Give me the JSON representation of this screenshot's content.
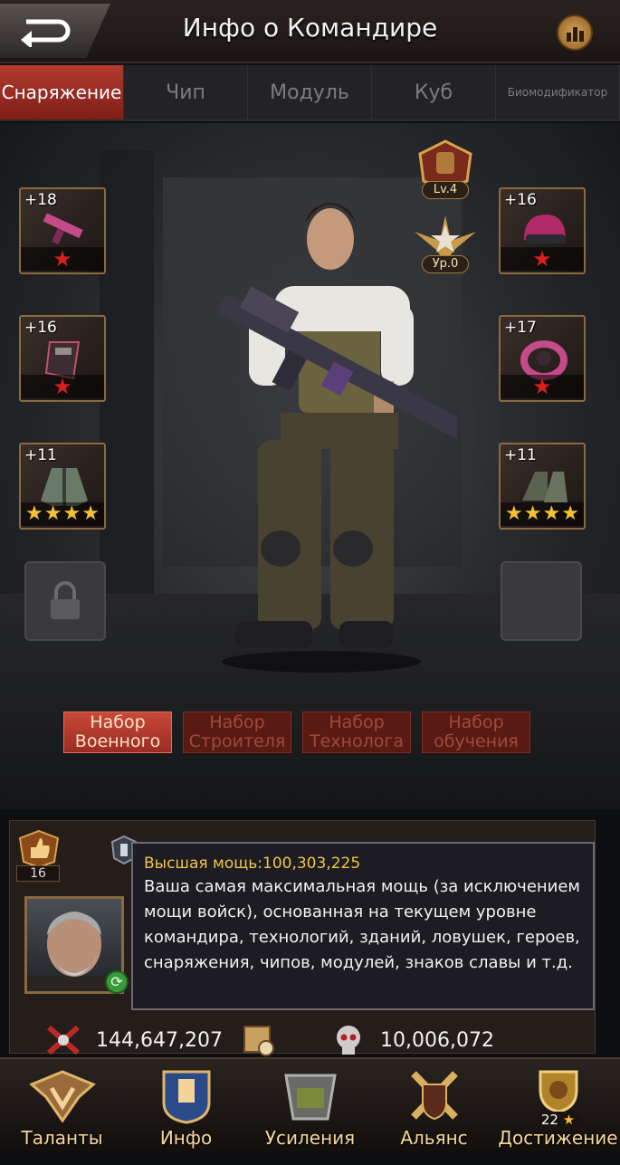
{
  "header": {
    "title": "Инфо о Командире"
  },
  "tabs": [
    {
      "label": "Снаряжение",
      "active": true
    },
    {
      "label": "Чип",
      "active": false
    },
    {
      "label": "Модуль",
      "active": false
    },
    {
      "label": "Куб",
      "active": false
    },
    {
      "label": "Биомодификатор",
      "active": false
    }
  ],
  "gear": {
    "left": [
      {
        "name": "weapon",
        "level": "+18",
        "stars": 1,
        "star_color": "red"
      },
      {
        "name": "badge-armor",
        "level": "+16",
        "stars": 1,
        "star_color": "red"
      },
      {
        "name": "jacket",
        "level": "+11",
        "stars": 4,
        "star_color": "gold"
      }
    ],
    "right": [
      {
        "name": "helmet",
        "level": "+16",
        "stars": 1,
        "star_color": "red"
      },
      {
        "name": "ring",
        "level": "+17",
        "stars": 1,
        "star_color": "red"
      },
      {
        "name": "boots",
        "level": "+11",
        "stars": 4,
        "star_color": "gold"
      }
    ]
  },
  "badges": {
    "armor_level": "Lv.4",
    "rank_level": "Ур.0"
  },
  "sets": [
    {
      "label": "Набор Военного",
      "active": true
    },
    {
      "label": "Набор Строителя",
      "active": false
    },
    {
      "label": "Набор Технолога",
      "active": false
    },
    {
      "label": "Набор обучения",
      "active": false
    }
  ],
  "commander": {
    "rank": "16"
  },
  "tooltip": {
    "title": "Высшая мощь:100,303,225",
    "body": "Ваша самая максимальная мощь (за исключением мощи войск), основанная на текущем уровне командира, технологий, зданий, ловушек, героев, снаряжения, чипов, модулей, знаков славы и т.д."
  },
  "stats": {
    "power": "144,647,207",
    "kills": "10,006,072"
  },
  "bottom_nav": [
    {
      "label": "Таланты"
    },
    {
      "label": "Инфо"
    },
    {
      "label": "Усиления"
    },
    {
      "label": "Альянс"
    },
    {
      "label": "Достижение",
      "count": "22"
    }
  ],
  "colors": {
    "accent_red": "#b33a2e",
    "gold": "#f2c230",
    "tooltip_title": "#f2c34a"
  }
}
